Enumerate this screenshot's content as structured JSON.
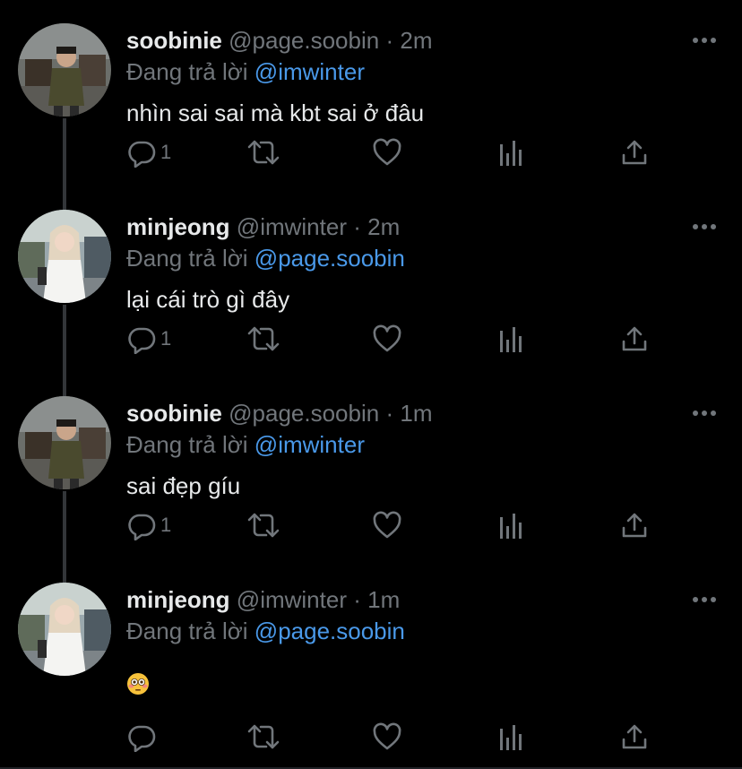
{
  "reply_prefix": "Đang trả lời",
  "colors": {
    "background": "#000000",
    "text": "#e7e9ea",
    "muted": "#71767b",
    "mention": "#4a99e9",
    "thread_line": "#333639"
  },
  "icons": {
    "more": "more-horizontal-icon",
    "reply": "reply-bubble-icon",
    "retweet": "retweet-icon",
    "like": "heart-icon",
    "analytics": "bar-chart-icon",
    "share": "share-upload-icon",
    "emoji": "flushed-face-emoji"
  },
  "tweets": [
    {
      "name": "soobinie",
      "handle": "@page.soobin",
      "dot": "·",
      "time": "2m",
      "reply_to": "@imwinter",
      "text": "nhìn sai sai mà kbt sai ở đâu",
      "reply_count": "1"
    },
    {
      "name": "minjeong",
      "handle": "@imwinter",
      "dot": "·",
      "time": "2m",
      "reply_to": "@page.soobin",
      "text": "lại cái trò gì đây",
      "reply_count": "1"
    },
    {
      "name": "soobinie",
      "handle": "@page.soobin",
      "dot": "·",
      "time": "1m",
      "reply_to": "@imwinter",
      "text": "sai đẹp gíu",
      "reply_count": "1"
    },
    {
      "name": "minjeong",
      "handle": "@imwinter",
      "dot": "·",
      "time": "1m",
      "reply_to": "@page.soobin",
      "text": "",
      "reply_count": ""
    }
  ]
}
